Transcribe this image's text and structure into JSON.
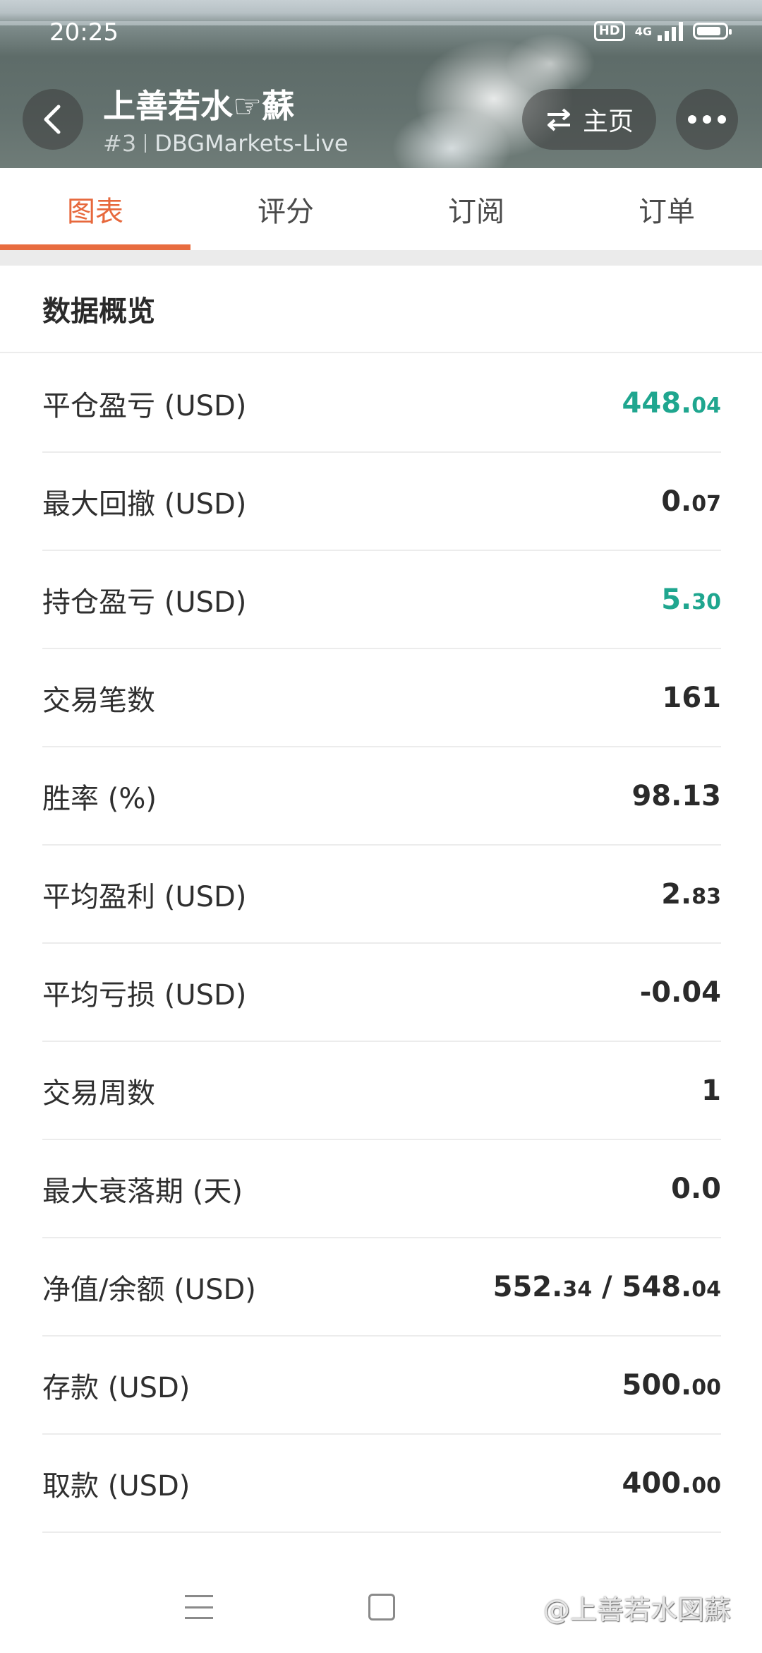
{
  "status_bar": {
    "time": "20:25",
    "hd_label": "HD",
    "network_label": "4G",
    "icons": [
      "hd-icon",
      "signal-icon",
      "battery-icon"
    ]
  },
  "header": {
    "title": "上善若水☞蘇",
    "rank": "#3",
    "broker": "DBGMarkets-Live",
    "home_button_label": "主页",
    "icons": [
      "back-icon",
      "swap-icon",
      "more-icon"
    ]
  },
  "tabs": [
    {
      "label": "图表",
      "active": true
    },
    {
      "label": "评分",
      "active": false
    },
    {
      "label": "订阅",
      "active": false
    },
    {
      "label": "订单",
      "active": false
    }
  ],
  "overview": {
    "title": "数据概览",
    "rows": [
      {
        "label": "平仓盈亏 (USD)",
        "int": "448.",
        "dec": "04",
        "color": "#1fa68f"
      },
      {
        "label": "最大回撤 (USD)",
        "int": "0.",
        "dec": "07"
      },
      {
        "label": "持仓盈亏 (USD)",
        "int": "5.",
        "dec": "30",
        "color": "#1fa68f"
      },
      {
        "label": "交易笔数",
        "int": "161",
        "dec": ""
      },
      {
        "label": "胜率 (%)",
        "int": "98.13",
        "dec": ""
      },
      {
        "label": "平均盈利 (USD)",
        "int": "2.",
        "dec": "83"
      },
      {
        "label": "平均亏损 (USD)",
        "int": "-0.04",
        "dec": ""
      },
      {
        "label": "交易周数",
        "int": "1",
        "dec": ""
      },
      {
        "label": "最大衰落期 (天)",
        "int": "0.0",
        "dec": ""
      },
      {
        "label": "净值/余额 (USD)",
        "int": "552.",
        "dec": "34",
        "int2": " / 548.",
        "dec2": "04"
      },
      {
        "label": "存款 (USD)",
        "int": "500.",
        "dec": "00"
      },
      {
        "label": "取款 (USD)",
        "int": "400.",
        "dec": "00"
      }
    ]
  },
  "nav_bar": {
    "icons": [
      "menu-icon",
      "home-square-icon"
    ],
    "watermark": "@上善若水図蘇"
  }
}
